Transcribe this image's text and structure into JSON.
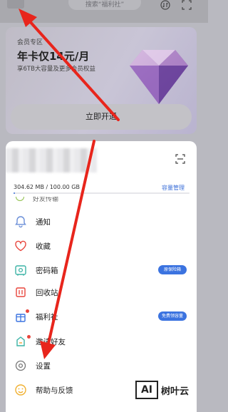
{
  "header": {
    "search_placeholder": "搜索“福利社”"
  },
  "vip": {
    "zone_label": "会员专区",
    "price_title": "年卡仅14元/月",
    "description": "享6TB大容量及更多会员权益",
    "open_button": "立即开通"
  },
  "account": {
    "storage_used_text": "304.62 MB / 100.00 GB",
    "storage_manage_link": "容量管理",
    "storage_fraction": 0.003
  },
  "menu": {
    "partial_item": "好友传输",
    "items": [
      {
        "label": "通知",
        "icon": "bell-icon"
      },
      {
        "label": "收藏",
        "icon": "heart-icon"
      },
      {
        "label": "密码箱",
        "icon": "safe-icon",
        "badge": "原保险箱"
      },
      {
        "label": "回收站",
        "icon": "trash-icon"
      },
      {
        "label": "福利社",
        "icon": "gift-icon",
        "badge": "免费领容量"
      },
      {
        "label": "邀请好友",
        "icon": "invite-icon"
      },
      {
        "label": "设置",
        "icon": "gear-icon"
      },
      {
        "label": "帮助与反馈",
        "icon": "smile-icon"
      }
    ]
  },
  "watermark": {
    "logo": "AI",
    "text": "树叶云"
  },
  "colors": {
    "accent": "#3b73e0",
    "arrow": "#e8251c",
    "badge_text": "#ffffff"
  }
}
